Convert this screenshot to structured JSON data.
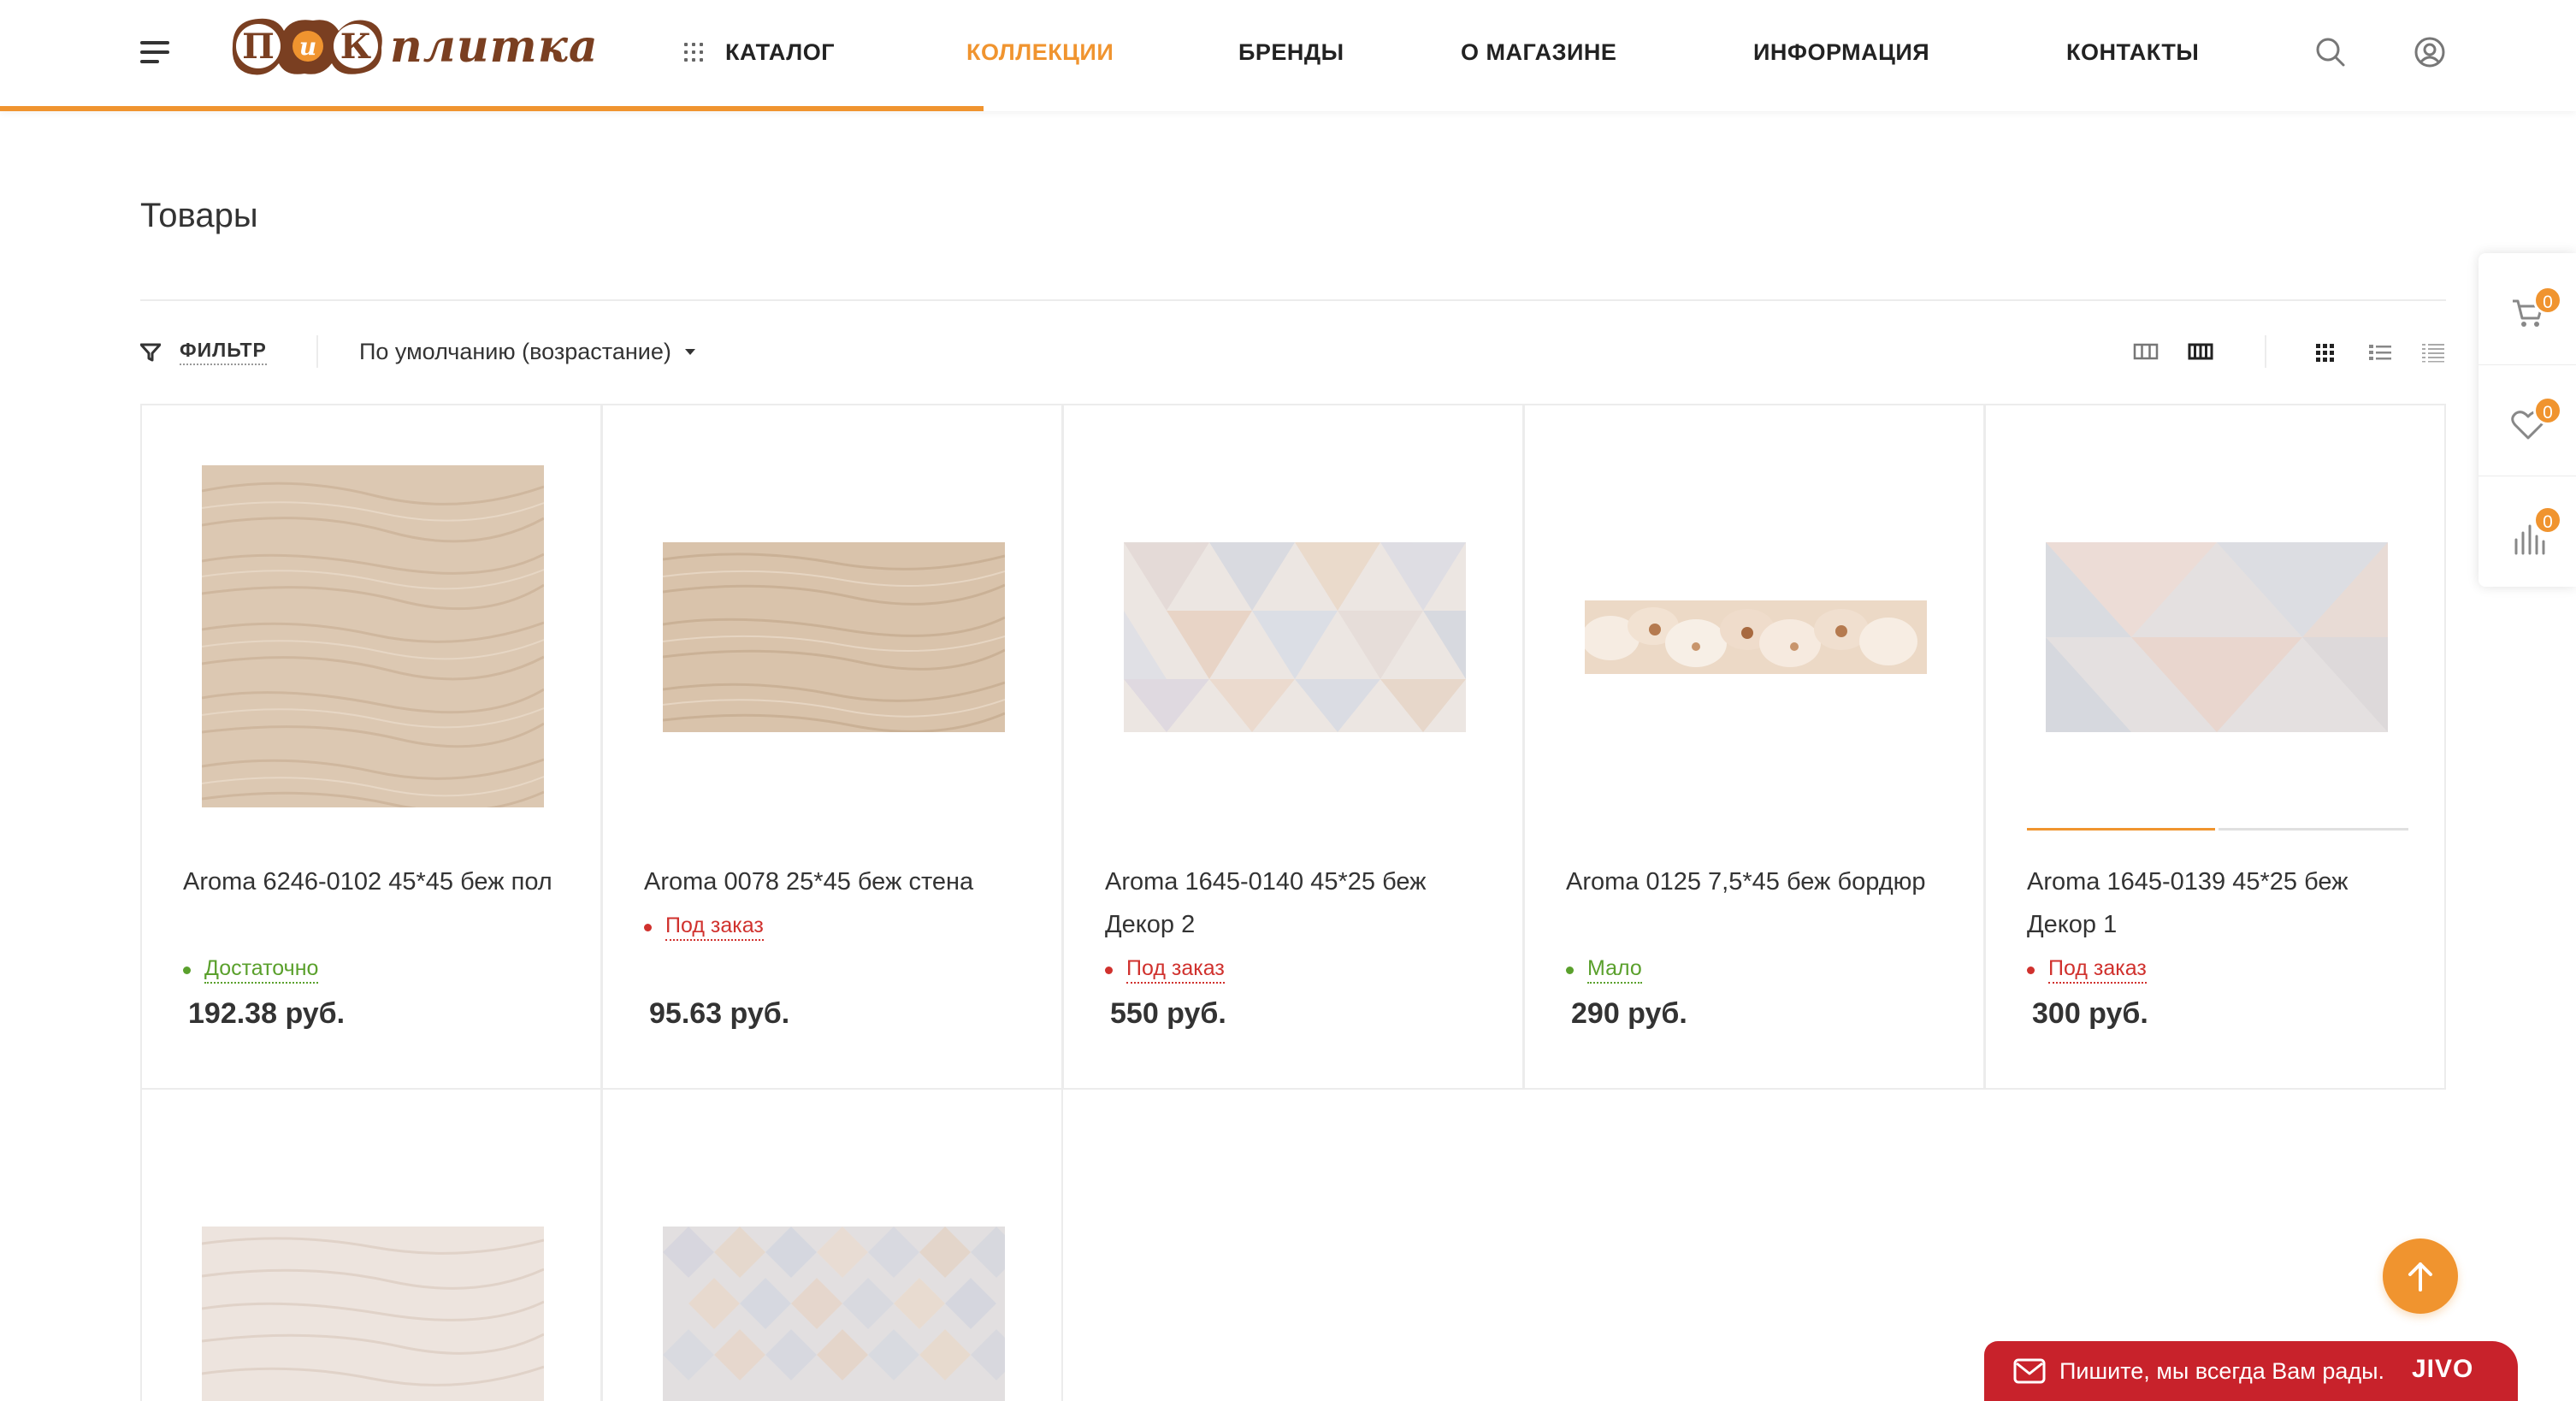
{
  "header": {
    "logo_mark": "ПиК",
    "logo_text": "плитка",
    "nav": [
      {
        "label": "КАТАЛОГ"
      },
      {
        "label": "КОЛЛЕКЦИИ"
      },
      {
        "label": "БРЕНДЫ"
      },
      {
        "label": "О МАГАЗИНЕ"
      },
      {
        "label": "ИНФОРМАЦИЯ"
      },
      {
        "label": "КОНТАКТЫ"
      }
    ],
    "active_nav": "КОЛЛЕКЦИИ"
  },
  "page": {
    "title": "Товары"
  },
  "toolbar": {
    "filter_label": "ФИЛЬТР",
    "sort_value": "По умолчанию (возрастание)"
  },
  "products": [
    {
      "name": "Aroma 6246-0102 45*45 беж пол",
      "status": "Достаточно",
      "status_type": "available",
      "price": "192.38 руб.",
      "pattern": "wood-beige"
    },
    {
      "name": "Aroma 0078 25*45 беж стена",
      "status": "Под заказ",
      "status_type": "order",
      "price": "95.63 руб.",
      "pattern": "wood-beige"
    },
    {
      "name": "Aroma 1645-0140 45*25 беж Декор 2",
      "status": "Под заказ",
      "status_type": "order",
      "price": "550 руб.",
      "pattern": "triangles"
    },
    {
      "name": "Aroma 0125 7,5*45 беж бордюр",
      "status": "Мало",
      "status_type": "available",
      "price": "290 руб.",
      "pattern": "orchids"
    },
    {
      "name": "Aroma 1645-0139 45*25 беж Декор 1",
      "status": "Под заказ",
      "status_type": "order",
      "price": "300 руб.",
      "pattern": "triangles-large"
    },
    {
      "name": "",
      "status": "",
      "status_type": "",
      "price": "",
      "pattern": "wood-light"
    },
    {
      "name": "",
      "status": "",
      "status_type": "",
      "price": "",
      "pattern": "diamonds"
    }
  ],
  "side_panel": {
    "cart_count": "0",
    "favorites_count": "0",
    "compare_count": "0"
  },
  "chat": {
    "text": "Пишите, мы всегда Вам рады.",
    "brand": "JIVO"
  },
  "colors": {
    "accent": "#f0942f",
    "available": "#5aa02c",
    "order": "#d0312d",
    "logo_brown": "#7a3f21",
    "jivo_red": "#c8222b"
  },
  "icons": [
    "burger-menu-icon",
    "catalog-grid-icon",
    "search-icon",
    "user-icon",
    "filter-icon",
    "cart-icon",
    "heart-icon",
    "compare-icon",
    "arrow-up-icon",
    "mail-icon"
  ]
}
